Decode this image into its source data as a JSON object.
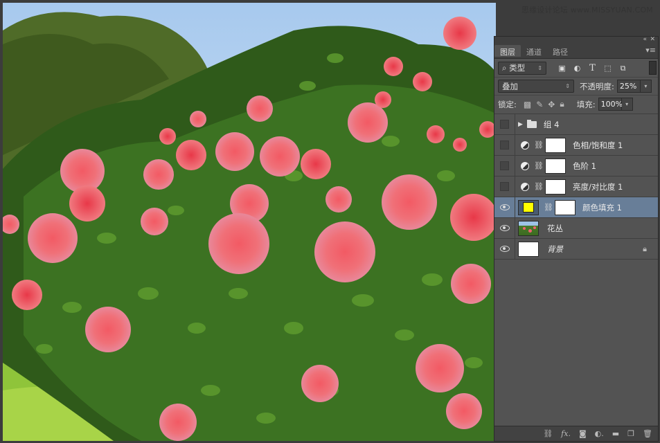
{
  "watermark": "思缘设计论坛 www.MISSYUAN.COM",
  "panel": {
    "collapse_icon": "double-chevron-icon",
    "close_icon": "close-icon",
    "tabs": [
      "图层",
      "通道",
      "路径"
    ],
    "active_tab": "图层",
    "menu_icon": "panel-menu-icon",
    "filter": {
      "selected": "类型",
      "icons": [
        "image-filter-icon",
        "adjustment-filter-icon",
        "type-filter-icon",
        "shape-filter-icon",
        "smart-object-filter-icon"
      ]
    },
    "blend_mode": "叠加",
    "opacity_label": "不透明度:",
    "opacity_value": "25%",
    "lock_label": "锁定:",
    "lock_icons": [
      "lock-transparent-icon",
      "lock-image-icon",
      "lock-position-icon",
      "lock-all-icon"
    ],
    "fill_label": "填充:",
    "fill_value": "100%",
    "layers": [
      {
        "name": "组 4",
        "type": "group",
        "visible": false
      },
      {
        "name": "色相/饱和度 1",
        "type": "adjustment",
        "visible": false
      },
      {
        "name": "色阶 1",
        "type": "adjustment",
        "visible": false
      },
      {
        "name": "亮度/对比度 1",
        "type": "adjustment",
        "visible": false
      },
      {
        "name": "颜色填充 1",
        "type": "fill",
        "visible": true,
        "selected": true,
        "fill_color": "#ffff00"
      },
      {
        "name": "花丛",
        "type": "image",
        "visible": true
      },
      {
        "name": "背景",
        "type": "background",
        "visible": true,
        "locked": true
      }
    ],
    "bottom_icons": [
      "link-layers-icon",
      "fx-icon",
      "add-mask-icon",
      "new-adjustment-icon",
      "new-group-icon",
      "new-layer-icon",
      "delete-layer-icon"
    ]
  },
  "colors": {
    "selected_row": "#687e98",
    "panel_bg": "#535353"
  }
}
